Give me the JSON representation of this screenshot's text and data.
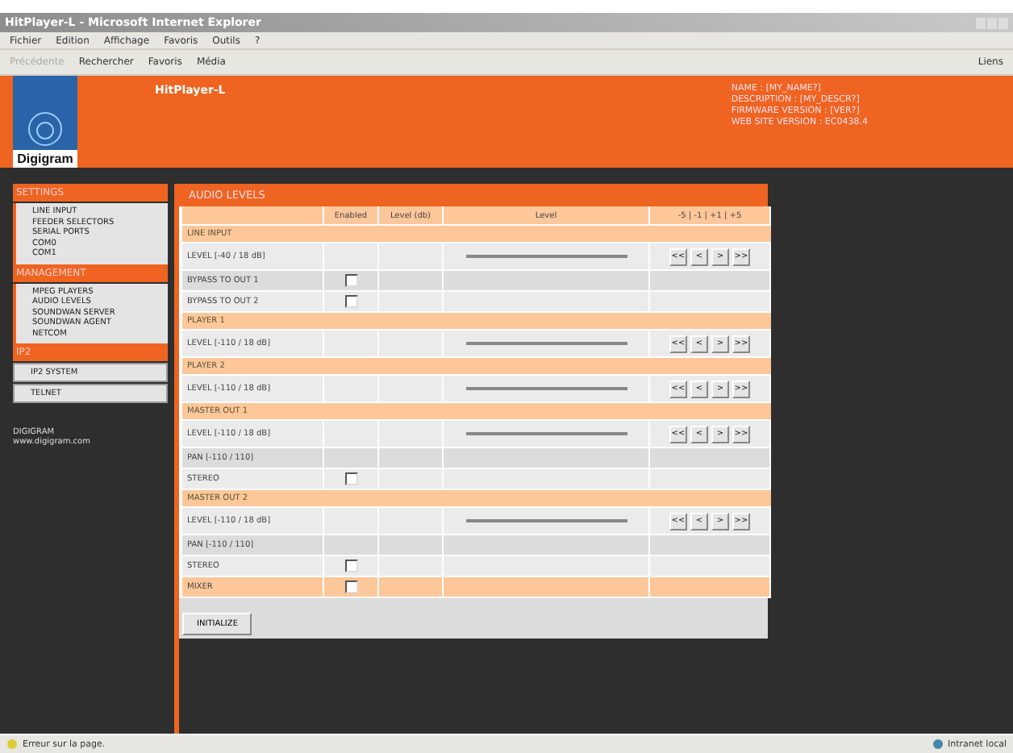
{
  "window": {
    "title": "HitPlayer-L - Microsoft Internet Explorer"
  },
  "menu": [
    "Fichier",
    "Edition",
    "Affichage",
    "Favoris",
    "Outils",
    "?"
  ],
  "toolbar": [
    {
      "label": "Précédente",
      "disabled": true
    },
    {
      "label": "Rechercher",
      "disabled": false
    },
    {
      "label": "Favoris",
      "disabled": false
    },
    {
      "label": "Média",
      "disabled": false
    }
  ],
  "links_label": "Liens",
  "header": {
    "logo": "Digigram",
    "title": "HitPlayer-L",
    "info": [
      "NAME : [MY_NAME?]",
      "DESCRIPTION : [MY_DESCR?]",
      "FIRMWARE VERSION : [VER?]",
      "WEB SITE VERSION : EC0438.4"
    ]
  },
  "sidebar": {
    "sections": [
      {
        "title": "SETTINGS",
        "kind": "list",
        "items": [
          "LINE INPUT",
          "FEEDER SELECTORS",
          "SERIAL PORTS",
          "COM0",
          "COM1"
        ]
      },
      {
        "title": "MANAGEMENT",
        "kind": "list",
        "items": [
          "MPEG PLAYERS",
          "AUDIO LEVELS",
          "SOUNDWAN SERVER",
          "SOUNDWAN AGENT",
          "NETCOM"
        ]
      },
      {
        "title": "IP2",
        "kind": "buttons",
        "items": [
          "IP2 SYSTEM",
          "TELNET"
        ]
      }
    ],
    "footer": [
      "DIGIGRAM",
      "www.digigram.com"
    ]
  },
  "panel": {
    "title": "AUDIO LEVELS",
    "columns": [
      "Enabled",
      "Level (db)",
      "Level",
      "-5 | -1 | +1 | +5"
    ],
    "rows": [
      {
        "kind": "section",
        "label": "LINE INPUT"
      },
      {
        "kind": "level",
        "label": "LEVEL [-40 / 18 dB]",
        "buttons": [
          "<<",
          "<",
          ">",
          ">>"
        ]
      },
      {
        "kind": "check",
        "label": "BYPASS TO OUT 1",
        "checked": false
      },
      {
        "kind": "check",
        "label": "BYPASS TO OUT 2",
        "checked": false
      },
      {
        "kind": "section",
        "label": "PLAYER 1"
      },
      {
        "kind": "level",
        "label": "LEVEL [-110 / 18 dB]",
        "buttons": [
          "<<",
          "<",
          ">",
          ">>"
        ]
      },
      {
        "kind": "section",
        "label": "PLAYER 2"
      },
      {
        "kind": "level",
        "label": "LEVEL [-110 / 18 dB]",
        "buttons": [
          "<<",
          "<",
          ">",
          ">>"
        ]
      },
      {
        "kind": "section",
        "label": "MASTER OUT 1"
      },
      {
        "kind": "level",
        "label": "LEVEL [-110 / 18 dB]",
        "buttons": [
          "<<",
          "<",
          ">",
          ">>"
        ]
      },
      {
        "kind": "plain",
        "label": "PAN [-110 / 110]"
      },
      {
        "kind": "check",
        "label": "STEREO",
        "checked": false
      },
      {
        "kind": "section",
        "label": "MASTER OUT 2"
      },
      {
        "kind": "level",
        "label": "LEVEL [-110 / 18 dB]",
        "buttons": [
          "<<",
          "<",
          ">",
          ">>"
        ]
      },
      {
        "kind": "plain",
        "label": "PAN [-110 / 110]"
      },
      {
        "kind": "check",
        "label": "STEREO",
        "checked": false
      },
      {
        "kind": "check",
        "label": "MIXER",
        "checked": false,
        "highlight": true
      }
    ],
    "action": "INITIALIZE"
  },
  "status_bar": {
    "message": "Erreur sur la page.",
    "zone": "Intranet local"
  }
}
